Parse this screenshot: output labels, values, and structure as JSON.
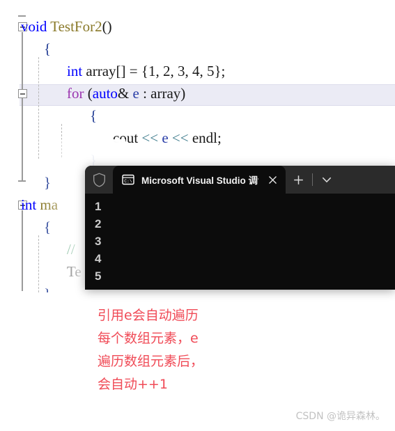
{
  "editor": {
    "name": "visual-studio-code-editor",
    "lines": [
      {
        "indent": 0,
        "segments": [
          {
            "text": "void ",
            "cls": "t-key"
          },
          {
            "text": "TestFor2",
            "cls": "t-fn"
          },
          {
            "text": "()",
            "cls": "t-plain"
          }
        ]
      },
      {
        "indent": 1,
        "segments": [
          {
            "text": "{",
            "cls": "t-brace"
          }
        ]
      },
      {
        "indent": 2,
        "segments": [
          {
            "text": "int ",
            "cls": "t-key"
          },
          {
            "text": "array[] = {1, 2, 3, 4, 5};",
            "cls": "t-plain"
          }
        ]
      },
      {
        "indent": 2,
        "segments": [
          {
            "text": "for ",
            "cls": "t-ctl"
          },
          {
            "text": "(",
            "cls": "t-plain"
          },
          {
            "text": "auto",
            "cls": "t-key"
          },
          {
            "text": "& ",
            "cls": "t-plain"
          },
          {
            "text": "e",
            "cls": "t-var"
          },
          {
            "text": " : array)",
            "cls": "t-plain"
          }
        ]
      },
      {
        "indent": 3,
        "segments": [
          {
            "text": "{",
            "cls": "t-brace"
          }
        ]
      },
      {
        "indent": 4,
        "segments": [
          {
            "text": "cout ",
            "cls": "t-plain"
          },
          {
            "text": "<<",
            "cls": "t-op"
          },
          {
            "text": " ",
            "cls": "t-plain"
          },
          {
            "text": "e",
            "cls": "t-var"
          },
          {
            "text": " ",
            "cls": "t-plain"
          },
          {
            "text": "<<",
            "cls": "t-op"
          },
          {
            "text": " endl;",
            "cls": "t-plain"
          }
        ]
      },
      {
        "indent": 3,
        "segments": [
          {
            "text": "}",
            "cls": "t-brace"
          }
        ]
      },
      {
        "indent": 1,
        "segments": [
          {
            "text": "}",
            "cls": "t-brace"
          }
        ]
      },
      {
        "indent": 0,
        "segments": [
          {
            "text": "int ",
            "cls": "t-key"
          },
          {
            "text": "ma",
            "cls": "t-fn"
          }
        ]
      },
      {
        "indent": 1,
        "segments": [
          {
            "text": "{",
            "cls": "t-brace"
          }
        ]
      },
      {
        "indent": 2,
        "segments": [
          {
            "text": "//",
            "cls": "t-com"
          }
        ]
      },
      {
        "indent": 2,
        "segments": [
          {
            "text": "Te",
            "cls": "t-plain"
          }
        ]
      },
      {
        "indent": 1,
        "segments": [
          {
            "text": "}",
            "cls": "t-brace"
          }
        ]
      }
    ],
    "highlighted_line_index": 3,
    "colors": {
      "keyword": "#0000ff",
      "function": "#8a7a2a",
      "control": "#9b36b0",
      "operator": "#3d7b8c",
      "comment": "#2e8b57",
      "current_line_highlight": "#ebebf5"
    }
  },
  "terminal": {
    "name": "windows-terminal",
    "shield_icon": "shield-icon",
    "tab": {
      "icon": "console-cmd-icon",
      "title": "Microsoft Visual Studio 调试控",
      "close_label": "×"
    },
    "new_tab_label": "+",
    "dropdown_label": "⌄",
    "output_lines": [
      "1",
      "2",
      "3",
      "4",
      "5"
    ],
    "colors": {
      "background": "#0c0c0c",
      "tabstrip": "#2b2b2b",
      "text": "#cccccc"
    }
  },
  "annotation": {
    "name": "red-handwritten-note",
    "color": "#f04b57",
    "lines": [
      "引用e会自动遍历",
      "每个数组元素，e",
      "遍历数组元素后，",
      "会自动++1"
    ]
  },
  "watermark": {
    "text": "CSDN @诡异森林。",
    "color": "#c2c2c2"
  }
}
